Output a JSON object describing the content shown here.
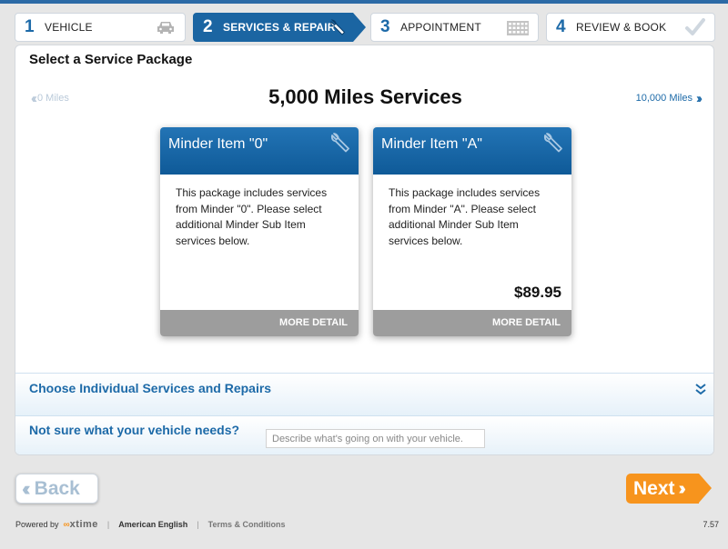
{
  "steps": [
    {
      "num": "1",
      "label": "VEHICLE",
      "icon": "car-icon",
      "state": "done"
    },
    {
      "num": "2",
      "label": "SERVICES & REPAIR",
      "icon": "wrench-icon",
      "state": "active"
    },
    {
      "num": "3",
      "label": "APPOINTMENT",
      "icon": "calendar-icon",
      "state": "pending"
    },
    {
      "num": "4",
      "label": "REVIEW & BOOK",
      "icon": "checkmark-icon",
      "state": "pending"
    }
  ],
  "section_title": "Select a Service Package",
  "nav": {
    "prev": "0 Miles",
    "next": "10,000 Miles",
    "current": "5,000 Miles Services"
  },
  "packages": [
    {
      "title": "Minder Item \"0\"",
      "description": "This package includes services from Minder \"0\". Please select additional Minder Sub Item services below.",
      "price": "",
      "detail": "MORE DETAIL"
    },
    {
      "title": "Minder Item \"A\"",
      "description": "This package includes services from Minder \"A\". Please select additional Minder Sub Item services below.",
      "price": "$89.95",
      "detail": "MORE DETAIL"
    }
  ],
  "individual": {
    "title": "Choose Individual Services and Repairs"
  },
  "needs": {
    "title": "Not sure what your vehicle needs?",
    "placeholder": "Describe what's going on with your vehicle."
  },
  "buttons": {
    "back": "Back",
    "next": "Next"
  },
  "footer": {
    "powered": "Powered by",
    "brand_mark": "∞",
    "brand_name": "xtime",
    "language": "American English",
    "terms": "Terms & Conditions",
    "version": "7.57"
  },
  "colors": {
    "primary": "#1b65a2",
    "accent": "#f7941d",
    "disabled": "#b9c9d9"
  }
}
